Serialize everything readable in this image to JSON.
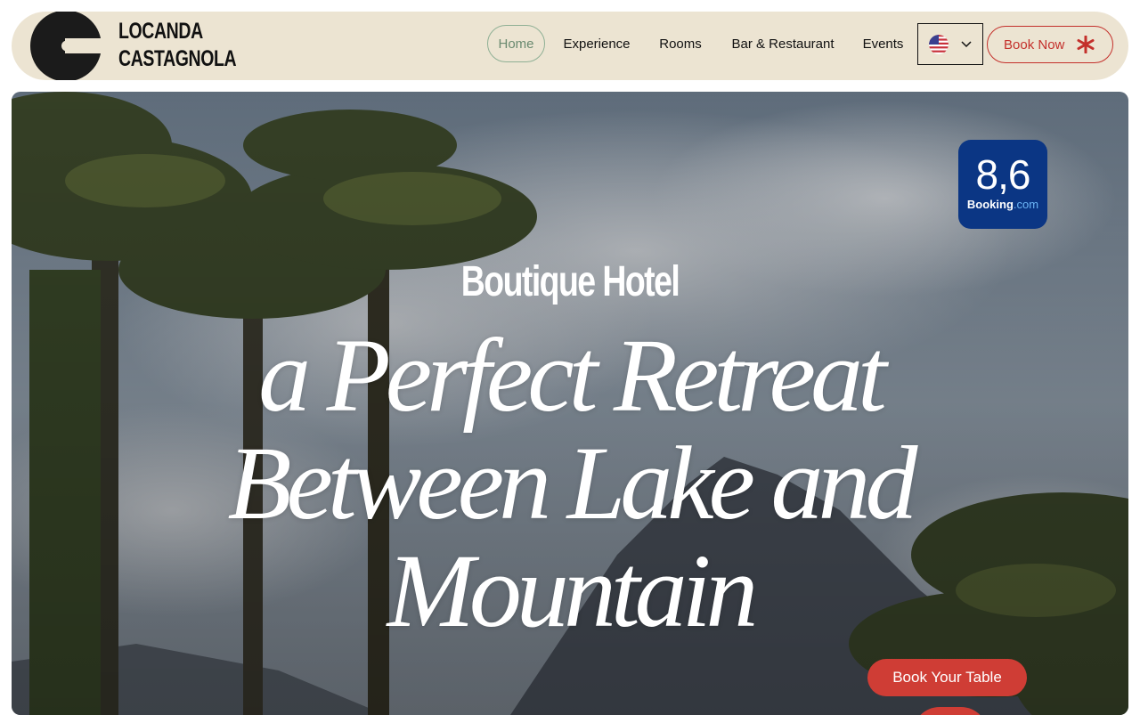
{
  "brand": {
    "line1": "LOCANDA",
    "line2": "CASTAGNOLA"
  },
  "nav": {
    "items": [
      {
        "label": "Home",
        "active": true
      },
      {
        "label": "Experience",
        "active": false
      },
      {
        "label": "Rooms",
        "active": false
      },
      {
        "label": "Bar & Restaurant",
        "active": false
      },
      {
        "label": "Events",
        "active": false
      }
    ],
    "language_icon": "us-flag-icon",
    "book_now_label": "Book Now",
    "book_now_icon": "asterisk-icon"
  },
  "hero": {
    "badge": {
      "score": "8,6",
      "brand_main": "Booking",
      "brand_suffix": ".com"
    },
    "subtitle": "Boutique Hotel",
    "headline": [
      "a Perfect Retreat",
      "Between Lake and",
      "Mountain"
    ],
    "cta_label": "Book Your Table"
  },
  "colors": {
    "header_bg": "#ece4d2",
    "accent_red": "#cf3d35",
    "booking_blue": "#0b3684",
    "active_green": "#8fb095"
  }
}
